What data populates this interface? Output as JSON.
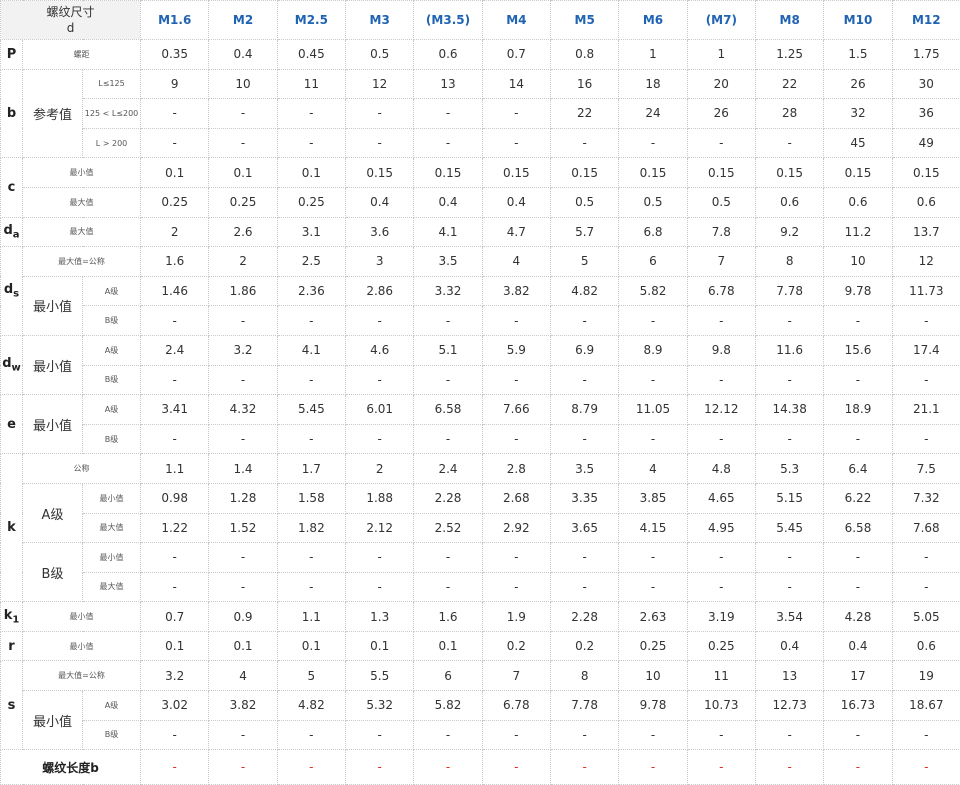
{
  "header": {
    "title_line1": "螺纹尺寸",
    "title_line2": "d",
    "sizes": [
      "M1.6",
      "M2",
      "M2.5",
      "M3",
      "(M3.5)",
      "M4",
      "M5",
      "M6",
      "(M7)",
      "M8",
      "M10",
      "M12"
    ]
  },
  "rows": [
    {
      "sym": "P",
      "sub": "",
      "g1": "",
      "g2": "螺距",
      "values": [
        "0.35",
        "0.4",
        "0.45",
        "0.5",
        "0.6",
        "0.7",
        "0.8",
        "1",
        "1",
        "1.25",
        "1.5",
        "1.75"
      ]
    },
    {
      "sym": "b",
      "sub": "",
      "g1": "参考值",
      "g2": "L≤125",
      "values": [
        "9",
        "10",
        "11",
        "12",
        "13",
        "14",
        "16",
        "18",
        "20",
        "22",
        "26",
        "30"
      ]
    },
    {
      "g2": "125 < L≤200",
      "values": [
        "-",
        "-",
        "-",
        "-",
        "-",
        "-",
        "22",
        "24",
        "26",
        "28",
        "32",
        "36"
      ]
    },
    {
      "g2": "L > 200",
      "values": [
        "-",
        "-",
        "-",
        "-",
        "-",
        "-",
        "-",
        "-",
        "-",
        "-",
        "45",
        "49"
      ]
    },
    {
      "sym": "c",
      "sub": "",
      "g1": "",
      "g2": "最小值",
      "values": [
        "0.1",
        "0.1",
        "0.1",
        "0.15",
        "0.15",
        "0.15",
        "0.15",
        "0.15",
        "0.15",
        "0.15",
        "0.15",
        "0.15"
      ]
    },
    {
      "g2": "最大值",
      "values": [
        "0.25",
        "0.25",
        "0.25",
        "0.4",
        "0.4",
        "0.4",
        "0.5",
        "0.5",
        "0.5",
        "0.6",
        "0.6",
        "0.6"
      ]
    },
    {
      "sym": "d",
      "sub": "a",
      "g1": "",
      "g2": "最大值",
      "values": [
        "2",
        "2.6",
        "3.1",
        "3.6",
        "4.1",
        "4.7",
        "5.7",
        "6.8",
        "7.8",
        "9.2",
        "11.2",
        "13.7"
      ]
    },
    {
      "sym": "d",
      "sub": "s",
      "g2": "最大值=公称",
      "values": [
        "1.6",
        "2",
        "2.5",
        "3",
        "3.5",
        "4",
        "5",
        "6",
        "7",
        "8",
        "10",
        "12"
      ]
    },
    {
      "g1": "最小值",
      "g2": "A级",
      "values": [
        "1.46",
        "1.86",
        "2.36",
        "2.86",
        "3.32",
        "3.82",
        "4.82",
        "5.82",
        "6.78",
        "7.78",
        "9.78",
        "11.73"
      ]
    },
    {
      "g2": "B级",
      "values": [
        "-",
        "-",
        "-",
        "-",
        "-",
        "-",
        "-",
        "-",
        "-",
        "-",
        "-",
        "-"
      ]
    },
    {
      "sym": "d",
      "sub": "w",
      "g1": "最小值",
      "g2": "A级",
      "values": [
        "2.4",
        "3.2",
        "4.1",
        "4.6",
        "5.1",
        "5.9",
        "6.9",
        "8.9",
        "9.8",
        "11.6",
        "15.6",
        "17.4"
      ]
    },
    {
      "g2": "B级",
      "values": [
        "-",
        "-",
        "-",
        "-",
        "-",
        "-",
        "-",
        "-",
        "-",
        "-",
        "-",
        "-"
      ]
    },
    {
      "sym": "e",
      "sub": "",
      "g1": "最小值",
      "g2": "A级",
      "values": [
        "3.41",
        "4.32",
        "5.45",
        "6.01",
        "6.58",
        "7.66",
        "8.79",
        "11.05",
        "12.12",
        "14.38",
        "18.9",
        "21.1"
      ]
    },
    {
      "g2": "B级",
      "values": [
        "-",
        "-",
        "-",
        "-",
        "-",
        "-",
        "-",
        "-",
        "-",
        "-",
        "-",
        "-"
      ]
    },
    {
      "sym": "k",
      "sub": "",
      "g2": "公称",
      "values": [
        "1.1",
        "1.4",
        "1.7",
        "2",
        "2.4",
        "2.8",
        "3.5",
        "4",
        "4.8",
        "5.3",
        "6.4",
        "7.5"
      ]
    },
    {
      "g1": "A级",
      "g2": "最小值",
      "values": [
        "0.98",
        "1.28",
        "1.58",
        "1.88",
        "2.28",
        "2.68",
        "3.35",
        "3.85",
        "4.65",
        "5.15",
        "6.22",
        "7.32"
      ]
    },
    {
      "g2": "最大值",
      "values": [
        "1.22",
        "1.52",
        "1.82",
        "2.12",
        "2.52",
        "2.92",
        "3.65",
        "4.15",
        "4.95",
        "5.45",
        "6.58",
        "7.68"
      ]
    },
    {
      "g1": "B级",
      "g2": "最小值",
      "values": [
        "-",
        "-",
        "-",
        "-",
        "-",
        "-",
        "-",
        "-",
        "-",
        "-",
        "-",
        "-"
      ]
    },
    {
      "g2": "最大值",
      "values": [
        "-",
        "-",
        "-",
        "-",
        "-",
        "-",
        "-",
        "-",
        "-",
        "-",
        "-",
        "-"
      ]
    },
    {
      "sym": "k",
      "sub": "1",
      "g1": "",
      "g2": "最小值",
      "values": [
        "0.7",
        "0.9",
        "1.1",
        "1.3",
        "1.6",
        "1.9",
        "2.28",
        "2.63",
        "3.19",
        "3.54",
        "4.28",
        "5.05"
      ]
    },
    {
      "sym": "r",
      "sub": "",
      "g1": "",
      "g2": "最小值",
      "values": [
        "0.1",
        "0.1",
        "0.1",
        "0.1",
        "0.1",
        "0.2",
        "0.2",
        "0.25",
        "0.25",
        "0.4",
        "0.4",
        "0.6"
      ]
    },
    {
      "sym": "s",
      "sub": "",
      "g2": "最大值=公称",
      "values": [
        "3.2",
        "4",
        "5",
        "5.5",
        "6",
        "7",
        "8",
        "10",
        "11",
        "13",
        "17",
        "19"
      ]
    },
    {
      "g1": "最小值",
      "g2": "A级",
      "values": [
        "3.02",
        "3.82",
        "4.82",
        "5.32",
        "5.82",
        "6.78",
        "7.78",
        "9.78",
        "10.73",
        "12.73",
        "16.73",
        "18.67"
      ]
    },
    {
      "g2": "B级",
      "values": [
        "-",
        "-",
        "-",
        "-",
        "-",
        "-",
        "-",
        "-",
        "-",
        "-",
        "-",
        "-"
      ]
    }
  ],
  "footer": {
    "label": "螺纹长度b",
    "values": [
      "-",
      "-",
      "-",
      "-",
      "-",
      "-",
      "-",
      "-",
      "-",
      "-",
      "-",
      "-"
    ],
    "value_color": "#e0301e"
  },
  "colors": {
    "size_header": "#1f63b3",
    "header_bg": "#f2f2f2",
    "border": "#c9c9c9"
  }
}
